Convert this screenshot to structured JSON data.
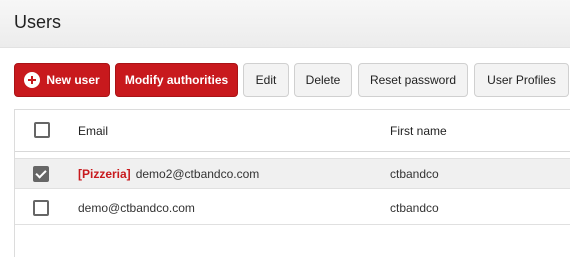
{
  "page": {
    "title": "Users"
  },
  "toolbar": {
    "new_user": "New user",
    "modify_authorities": "Modify authorities",
    "edit": "Edit",
    "delete": "Delete",
    "reset_password": "Reset password",
    "user_profiles": "User Profiles"
  },
  "table": {
    "columns": {
      "email": "Email",
      "first_name": "First name"
    },
    "rows": [
      {
        "tag": "[Pizzeria]",
        "email": "demo2@ctbandco.com",
        "first_name": "ctbandco",
        "selected": true
      },
      {
        "tag": "",
        "email": "demo@ctbandco.com",
        "first_name": "ctbandco",
        "selected": false
      }
    ]
  },
  "colors": {
    "accent": "#c8191d",
    "selected_row": "#f0f0f0",
    "checkbox": "#666666"
  }
}
